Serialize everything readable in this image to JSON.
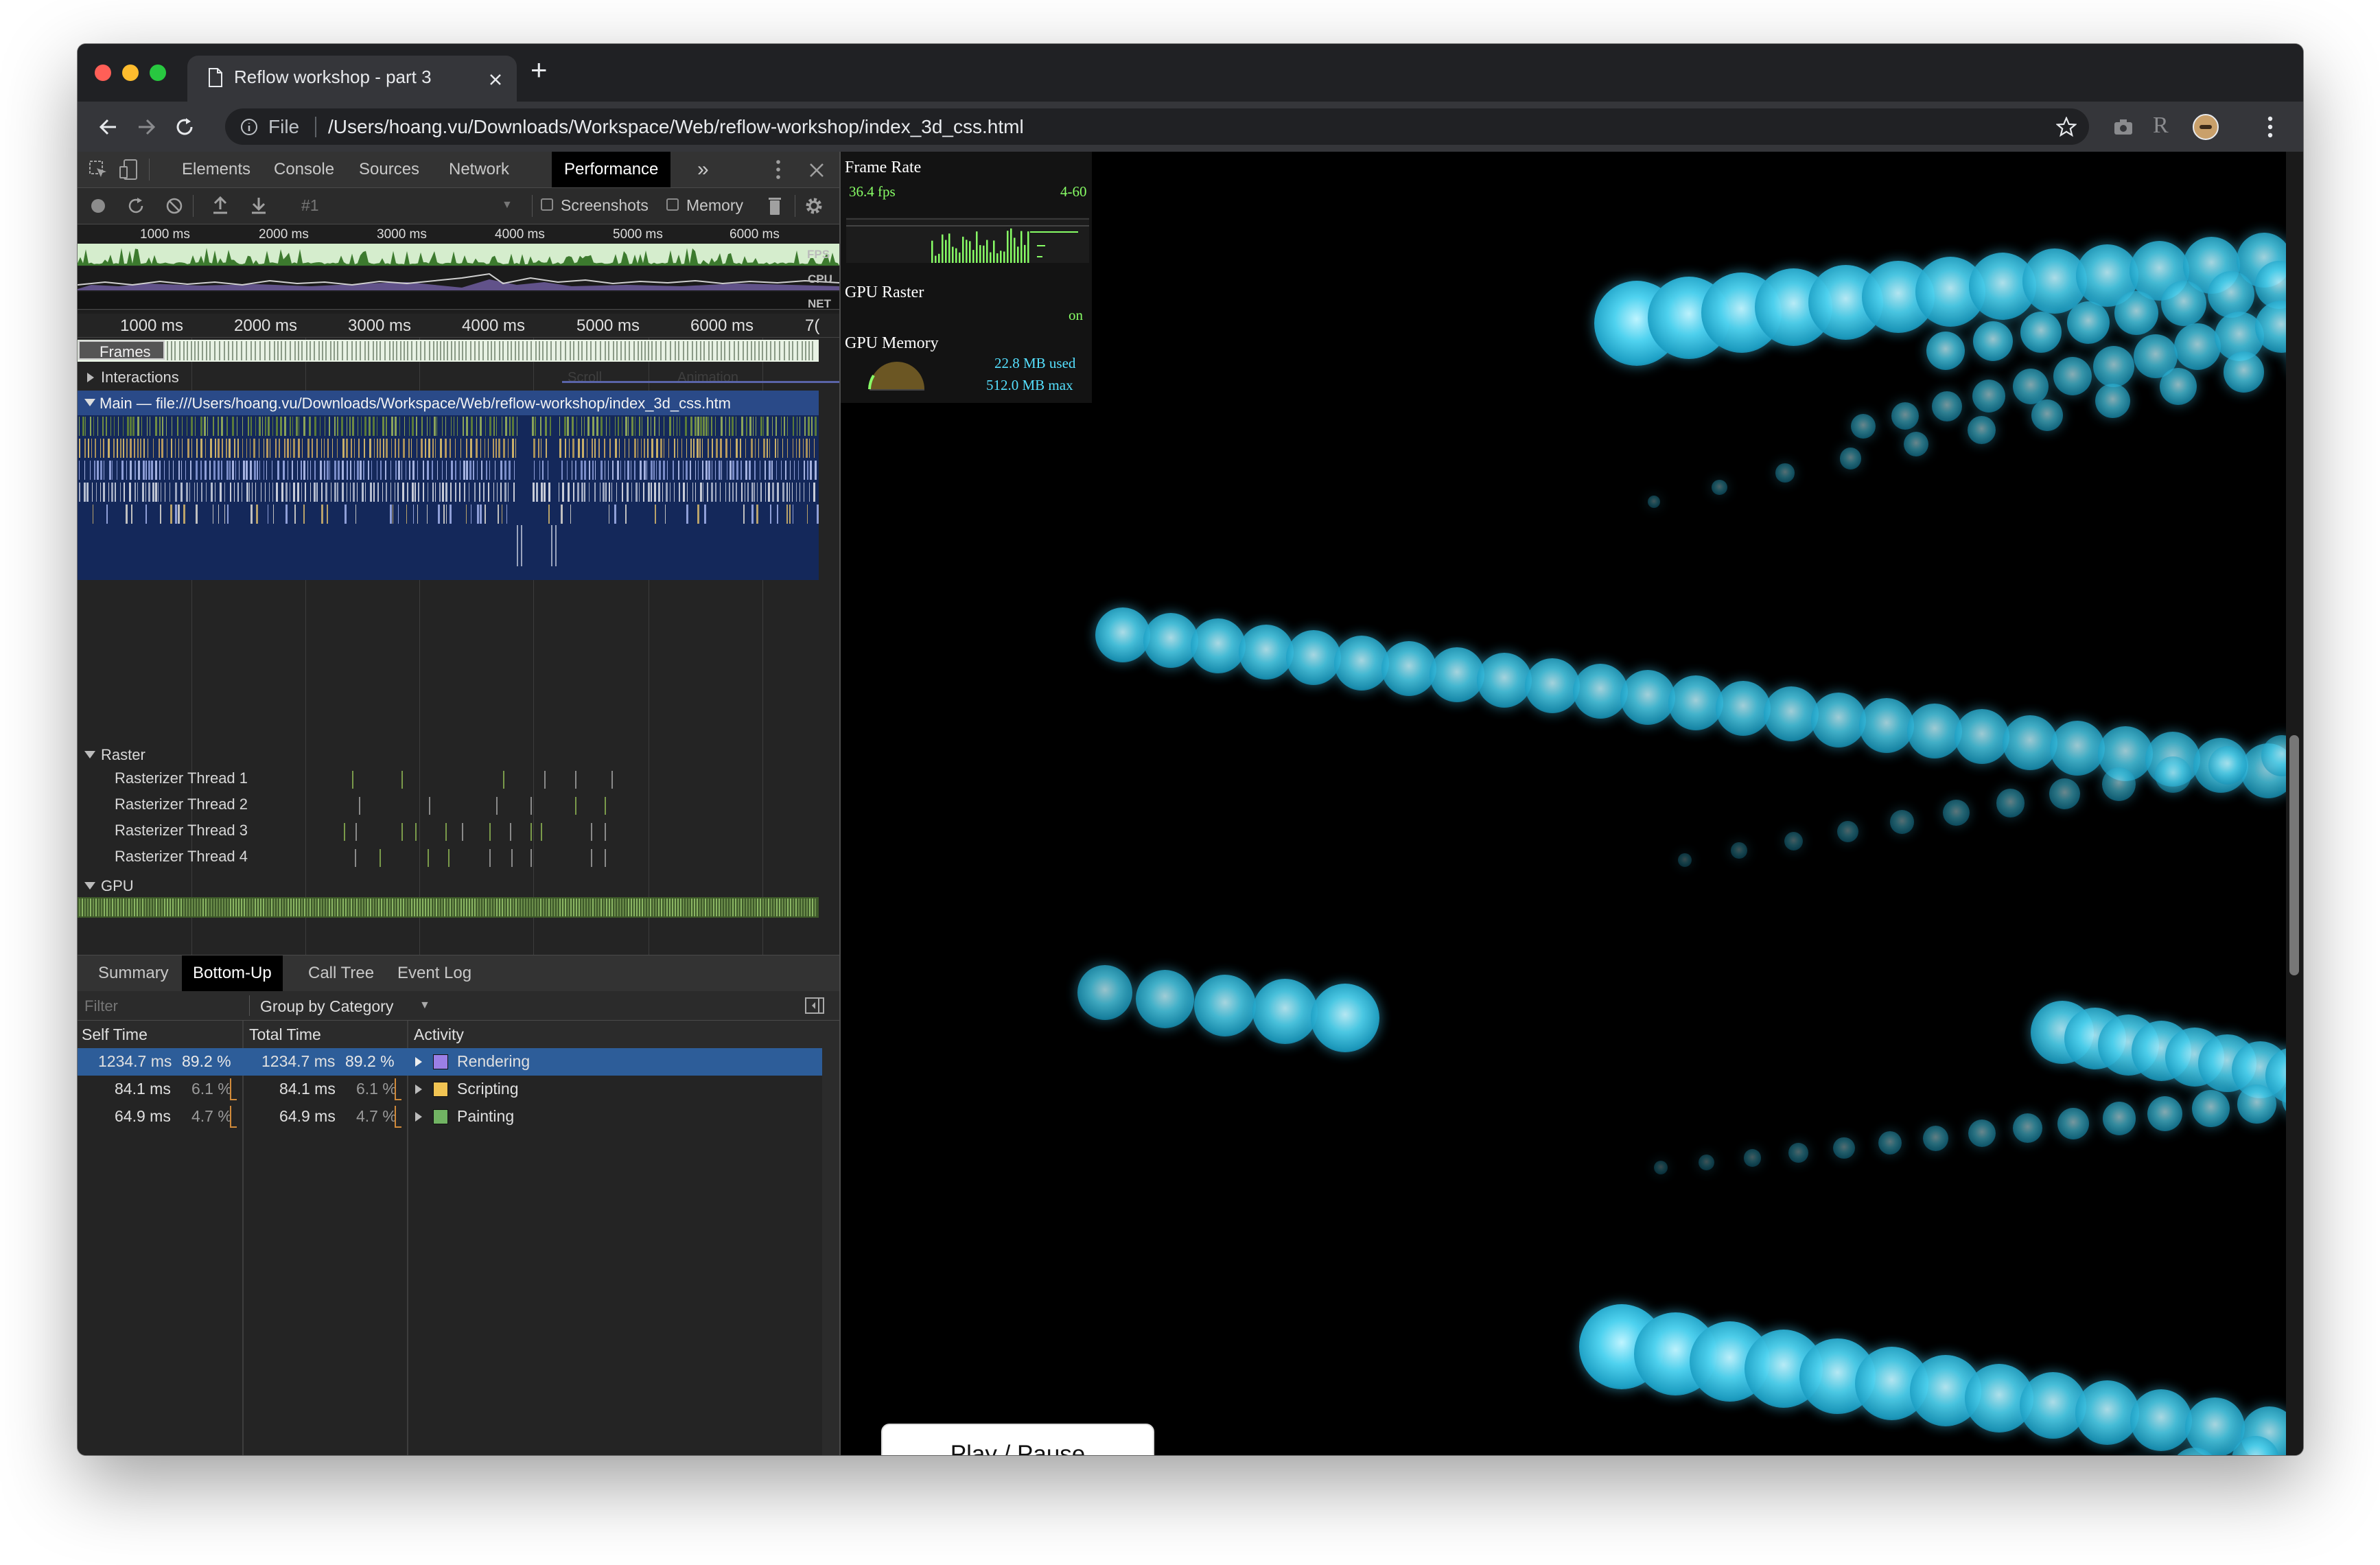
{
  "browser": {
    "tab_title": "Reflow workshop - part 3",
    "new_tab_label": "+",
    "url_scheme_label": "File",
    "url": "/Users/hoang.vu/Downloads/Workspace/Web/reflow-workshop/index_3d_css.html",
    "extension_letter": "R"
  },
  "devtools": {
    "tabs": [
      "Elements",
      "Console",
      "Sources",
      "Network",
      "Performance"
    ],
    "active_tab": "Performance",
    "more_tabs_label": "»",
    "controls": {
      "recording_select": "#1",
      "screenshots_label": "Screenshots",
      "memory_label": "Memory"
    },
    "overview": {
      "ticks": [
        "1000 ms",
        "2000 ms",
        "3000 ms",
        "4000 ms",
        "5000 ms",
        "6000 ms"
      ],
      "lanes": [
        "FPS",
        "CPU",
        "NET"
      ]
    },
    "timeline": {
      "ticks": [
        "1000 ms",
        "2000 ms",
        "3000 ms",
        "4000 ms",
        "5000 ms",
        "6000 ms",
        "7("
      ],
      "frames_label": "Frames",
      "interactions_label": "Interactions",
      "faint_labels": [
        "Scroll",
        "Animation"
      ],
      "main_label": "Main — file:///Users/hoang.vu/Downloads/Workspace/Web/reflow-workshop/index_3d_css.htm",
      "raster_label": "Raster",
      "raster_threads": [
        "Rasterizer Thread 1",
        "Rasterizer Thread 2",
        "Rasterizer Thread 3",
        "Rasterizer Thread 4"
      ],
      "gpu_label": "GPU"
    },
    "bottom": {
      "tabs": [
        "Summary",
        "Bottom-Up",
        "Call Tree",
        "Event Log"
      ],
      "active_tab": "Bottom-Up",
      "filter_placeholder": "Filter",
      "group_by": "Group by Category",
      "columns": [
        "Self Time",
        "Total Time",
        "Activity"
      ],
      "rows": [
        {
          "self_time": "1234.7 ms",
          "self_pct": "89.2 %",
          "total_time": "1234.7 ms",
          "total_pct": "89.2 %",
          "activity": "Rendering",
          "color": "#9b7fe6",
          "selected": true
        },
        {
          "self_time": "84.1 ms",
          "self_pct": "6.1 %",
          "total_time": "84.1 ms",
          "total_pct": "6.1 %",
          "activity": "Scripting",
          "color": "#f1c453",
          "selected": false
        },
        {
          "self_time": "64.9 ms",
          "self_pct": "4.7 %",
          "total_time": "64.9 ms",
          "total_pct": "4.7 %",
          "activity": "Painting",
          "color": "#71b363",
          "selected": false
        }
      ]
    }
  },
  "hud": {
    "frame_rate_label": "Frame Rate",
    "fps": "36.4 fps",
    "fps_range": "4-60",
    "gpu_raster_label": "GPU Raster",
    "gpu_raster_status": "on",
    "gpu_memory_label": "GPU Memory",
    "gpu_memory_used": "22.8 MB used",
    "gpu_memory_max": "512.0 MB max"
  },
  "page": {
    "play_pause_label": "Play / Pause"
  },
  "colors": {
    "accent": "#1a73e8",
    "selected_row": "#2d5d99",
    "ball": "#4fd2ef"
  }
}
